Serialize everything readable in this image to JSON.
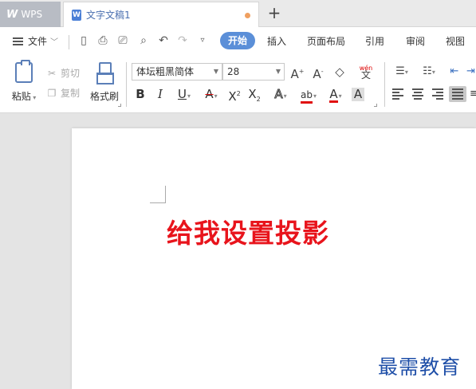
{
  "tabs": {
    "app_tab": "WPS",
    "app_logo": "W",
    "doc_tab": "文字文稿1",
    "doc_icon": "W",
    "add_glyph": "+"
  },
  "menu": {
    "file": "文件",
    "items": [
      "开始",
      "插入",
      "页面布局",
      "引用",
      "审阅",
      "视图"
    ],
    "active_index": 0,
    "accent": "#5b8fd8"
  },
  "ribbon": {
    "paste": "粘贴",
    "cut": "剪切",
    "copy": "复制",
    "format_painter": "格式刷",
    "font_name": "体坛粗黑简体",
    "font_size": "28",
    "phonetic": "wén",
    "phonetic_char": "文"
  },
  "document": {
    "text": "给我设置投影",
    "text_color": "#e8141c"
  },
  "watermark": {
    "text": "最需教育"
  }
}
